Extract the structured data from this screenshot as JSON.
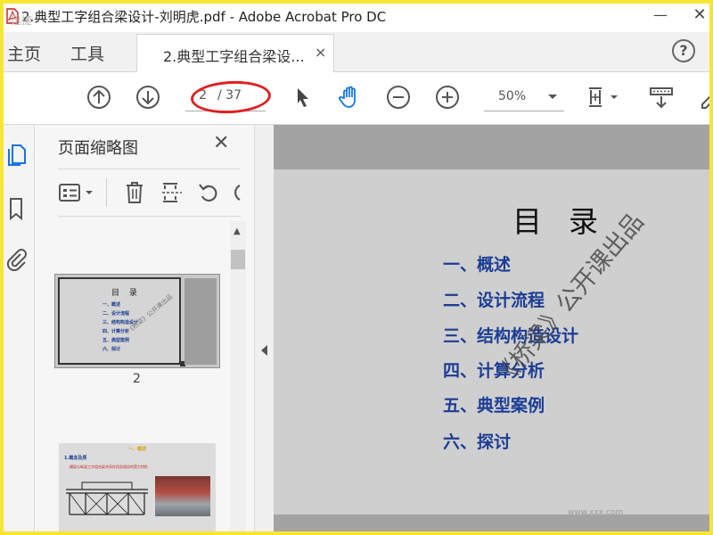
{
  "window": {
    "title": "2.典型工字组合梁设计-刘明虎.pdf - Adobe Acrobat Pro DC",
    "minimize_glyph": "—",
    "close_glyph": "✕",
    "overlay_text": "迅捷"
  },
  "tabs": {
    "home": "主页",
    "tools": "工具",
    "document": "2.典型工字组合梁设...",
    "close_glyph": "×",
    "help_glyph": "?"
  },
  "toolbar": {
    "page_current": "2",
    "page_total": "/ 37",
    "zoom": "50%",
    "icons": [
      "arrow-up-circle-icon",
      "arrow-down-circle-icon",
      "cursor-arrow-icon",
      "hand-tool-icon",
      "zoom-out-icon",
      "zoom-in-icon",
      "page-fit-icon",
      "scroll-mode-icon",
      "sign-icon"
    ]
  },
  "sidebar": {
    "icons": [
      "page-thumbnails-icon",
      "bookmarks-icon",
      "attachments-icon"
    ]
  },
  "thumbnails_panel": {
    "title": "页面缩略图",
    "close_glyph": "✕",
    "thumbnails": [
      {
        "page_label": "2",
        "title": "目 录",
        "items": [
          "一、概述",
          "二、设计流程",
          "三、结构构造设计",
          "四、计算分析",
          "五、典型案例",
          "六、探讨"
        ],
        "watermark": "《桥梁》公开课出品"
      },
      {
        "title": "一、概述",
        "heading": "1.概念及原",
        "line": "横梁与纵梁工字组合梁共同作用及相应的受力特性"
      }
    ]
  },
  "document": {
    "title": "目录",
    "toc": [
      "一、概述",
      "二、设计流程",
      "三、结构构造设计",
      "四、计算分析",
      "五、典型案例",
      "六、探讨"
    ],
    "watermark": "《桥梁》公开课出品",
    "footer_watermark": "www.xxx.com"
  },
  "colors": {
    "highlight_frame": "#f6e633",
    "annotation": "#e02020",
    "toc_text": "#1b3d94",
    "active_icon": "#1473e6"
  }
}
